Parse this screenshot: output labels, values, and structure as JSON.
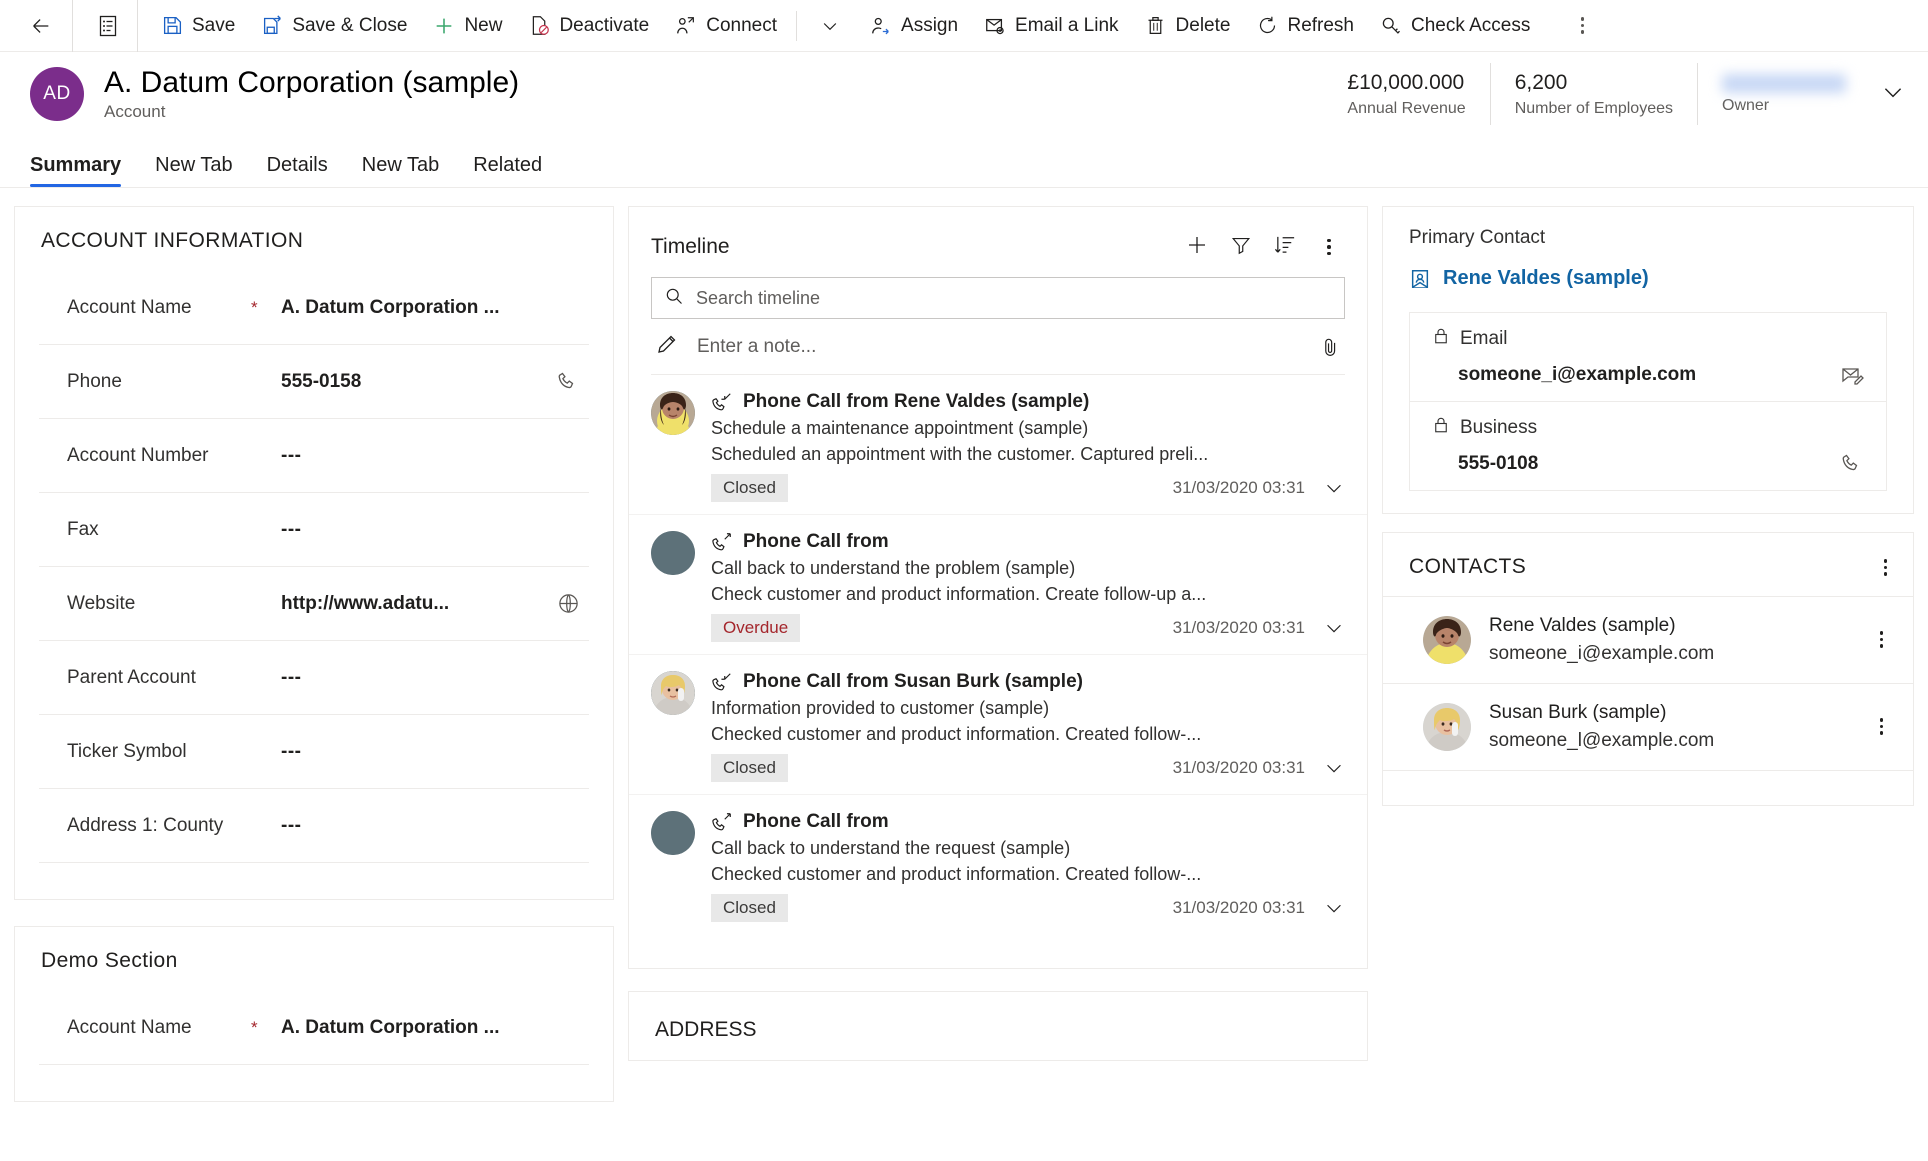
{
  "commandbar": {
    "back_label": "Back",
    "form_selector_label": "Form selector",
    "buttons": [
      {
        "label": "Save",
        "icon": "save-icon"
      },
      {
        "label": "Save & Close",
        "icon": "save-close-icon"
      },
      {
        "label": "New",
        "icon": "plus-icon"
      },
      {
        "label": "Deactivate",
        "icon": "deactivate-icon"
      },
      {
        "label": "Connect",
        "icon": "connect-icon"
      }
    ],
    "connect_chevron_label": "More connect options",
    "buttons2": [
      {
        "label": "Assign",
        "icon": "assign-icon"
      },
      {
        "label": "Email a Link",
        "icon": "email-link-icon"
      },
      {
        "label": "Delete",
        "icon": "trash-icon"
      },
      {
        "label": "Refresh",
        "icon": "refresh-icon"
      },
      {
        "label": "Check Access",
        "icon": "key-icon"
      }
    ],
    "overflow_label": "More commands"
  },
  "header": {
    "avatar_initials": "AD",
    "title": "A. Datum Corporation (sample)",
    "subtitle": "Account",
    "stats": [
      {
        "value": "£10,000.000",
        "label": "Annual Revenue"
      },
      {
        "value": "6,200",
        "label": "Number of Employees"
      },
      {
        "value": "",
        "label": "Owner",
        "redacted": true
      }
    ]
  },
  "tabs": [
    {
      "label": "Summary",
      "active": true
    },
    {
      "label": "New Tab",
      "active": false
    },
    {
      "label": "Details",
      "active": false
    },
    {
      "label": "New Tab",
      "active": false
    },
    {
      "label": "Related",
      "active": false
    }
  ],
  "account_information": {
    "title": "ACCOUNT INFORMATION",
    "fields": [
      {
        "label": "Account Name",
        "required": true,
        "value": "A. Datum Corporation ...",
        "action": ""
      },
      {
        "label": "Phone",
        "required": false,
        "value": "555-0158",
        "action": "phone-icon"
      },
      {
        "label": "Account Number",
        "required": false,
        "value": "---",
        "action": ""
      },
      {
        "label": "Fax",
        "required": false,
        "value": "---",
        "action": ""
      },
      {
        "label": "Website",
        "required": false,
        "value": "http://www.adatu...",
        "action": "globe-icon"
      },
      {
        "label": "Parent Account",
        "required": false,
        "value": "---",
        "action": ""
      },
      {
        "label": "Ticker Symbol",
        "required": false,
        "value": "---",
        "action": ""
      },
      {
        "label": "Address 1: County",
        "required": false,
        "value": "---",
        "action": ""
      }
    ]
  },
  "demo_section": {
    "title": "Demo Section",
    "fields": [
      {
        "label": "Account Name",
        "required": true,
        "value": "A. Datum Corporation ...",
        "action": ""
      }
    ]
  },
  "timeline": {
    "title": "Timeline",
    "actions": [
      {
        "name": "add",
        "icon": "plus-icon"
      },
      {
        "name": "filter",
        "icon": "filter-icon"
      },
      {
        "name": "sort",
        "icon": "sort-icon"
      },
      {
        "name": "more",
        "icon": "more-icon"
      }
    ],
    "search_placeholder": "Search timeline",
    "note_placeholder": "Enter a note...",
    "attach_label": "Attach file",
    "items": [
      {
        "title": "Phone Call from Rene Valdes (sample)",
        "subject": "Schedule a maintenance appointment (sample)",
        "description": "Scheduled an appointment with the customer. Captured preli...",
        "status": "Closed",
        "status_kind": "closed",
        "date": "31/03/2020 03:31",
        "avatar": "photo-rene",
        "call_direction": "incoming"
      },
      {
        "title": "Phone Call from",
        "subject": "Call back to understand the problem (sample)",
        "description": "Check customer and product information. Create follow-up a...",
        "status": "Overdue",
        "status_kind": "overdue",
        "date": "31/03/2020 03:31",
        "avatar": "placeholder",
        "call_direction": "outgoing"
      },
      {
        "title": "Phone Call from Susan Burk (sample)",
        "subject": "Information provided to customer (sample)",
        "description": "Checked customer and product information. Created follow-...",
        "status": "Closed",
        "status_kind": "closed",
        "date": "31/03/2020 03:31",
        "avatar": "photo-susan",
        "call_direction": "incoming"
      },
      {
        "title": "Phone Call from",
        "subject": "Call back to understand the request (sample)",
        "description": "Checked customer and product information. Created follow-...",
        "status": "Closed",
        "status_kind": "closed",
        "date": "31/03/2020 03:31",
        "avatar": "placeholder",
        "call_direction": "outgoing"
      }
    ]
  },
  "address": {
    "title": "ADDRESS"
  },
  "primary_contact": {
    "label": "Primary Contact",
    "name": "Rene Valdes (sample)",
    "rows": [
      {
        "label": "Email",
        "value": "someone_i@example.com",
        "action": "email-icon",
        "locked": true
      },
      {
        "label": "Business",
        "value": "555-0108",
        "action": "phone-icon",
        "locked": true
      }
    ]
  },
  "contacts": {
    "title": "CONTACTS",
    "more_label": "More commands",
    "items": [
      {
        "name": "Rene Valdes (sample)",
        "email": "someone_i@example.com",
        "avatar": "photo-rene"
      },
      {
        "name": "Susan Burk (sample)",
        "email": "someone_l@example.com",
        "avatar": "photo-susan"
      }
    ]
  },
  "colors": {
    "accent": "#2266e3",
    "avatar_purple": "#7b2d8b",
    "link_blue": "#1264a3",
    "required_red": "#a4262c",
    "overdue_red": "#a4262c"
  }
}
